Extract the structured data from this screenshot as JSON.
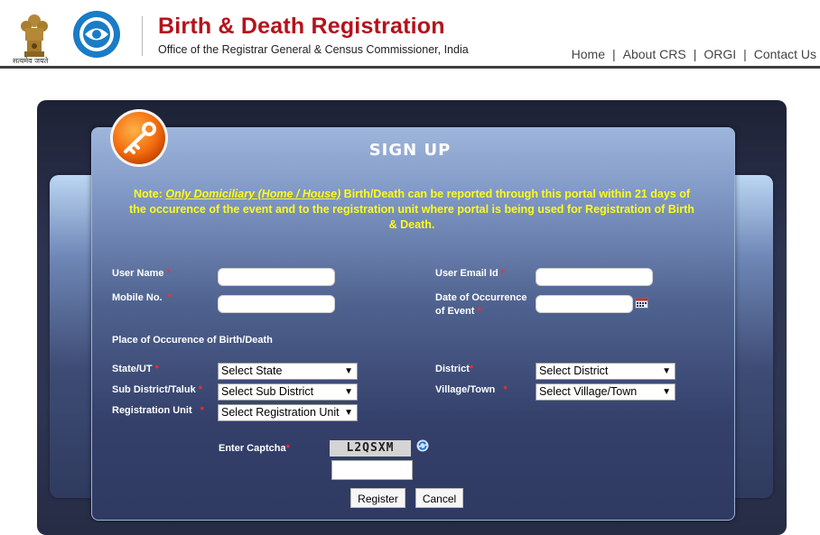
{
  "header": {
    "emblem_caption": "सत्यमेव जयते",
    "title": "Birth & Death Registration",
    "subtitle": "Office of the Registrar General & Census Commissioner, India",
    "nav": [
      {
        "label": "Home"
      },
      {
        "label": "About CRS"
      },
      {
        "label": "ORGI"
      },
      {
        "label": "Contact Us"
      }
    ],
    "separator": "|"
  },
  "panel": {
    "title": "SIGN UP",
    "note_prefix": "Note: ",
    "note_highlight": "Only Domiciliary (Home / House)",
    "note_rest": " Birth/Death can be reported through this portal within 21 days of the occurence of the event and to the registration unit where portal is being used for Registration of Birth & Death."
  },
  "form": {
    "required_mark": "*",
    "user_name_label": "User Name",
    "user_name_value": "",
    "user_email_label": "User Email Id",
    "user_email_value": "",
    "mobile_label": "Mobile No.",
    "mobile_value": "",
    "date_label_line1": "Date of Occurrence",
    "date_label_line2": "of Event",
    "date_value": "",
    "place_heading": "Place of Occurence of Birth/Death",
    "state_label": "State/UT",
    "state_selected": "Select State",
    "district_label": "District",
    "district_selected": "Select District",
    "subdistrict_label": "Sub District/Taluk",
    "subdistrict_selected": "Select Sub District",
    "village_label": "Village/Town",
    "village_selected": "Select Village/Town",
    "regunit_label": "Registration Unit",
    "regunit_selected": "Select Registration Unit",
    "captcha_label": "Enter Captcha",
    "captcha_text": "L2QSXM",
    "captcha_value": "",
    "register_button": "Register",
    "cancel_button": "Cancel",
    "dropdown_arrow": "▼"
  },
  "colors": {
    "brand_red": "#b5121b",
    "note_yellow": "#fffa1a",
    "required_red": "#ff2a2a"
  }
}
